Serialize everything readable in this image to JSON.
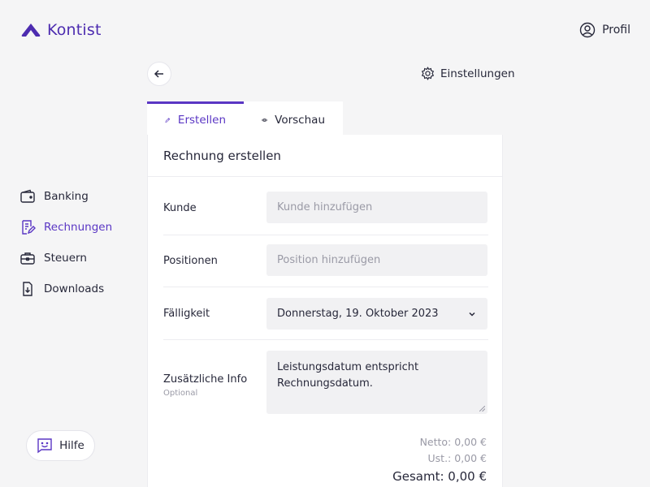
{
  "header": {
    "brand": "Kontist",
    "profile_label": "Profil"
  },
  "sidebar": {
    "items": [
      {
        "label": "Banking",
        "icon": "wallet-icon",
        "active": false
      },
      {
        "label": "Rechnungen",
        "icon": "invoice-icon",
        "active": true
      },
      {
        "label": "Steuern",
        "icon": "briefcase-icon",
        "active": false
      },
      {
        "label": "Downloads",
        "icon": "download-document-icon",
        "active": false
      }
    ],
    "help_label": "Hilfe"
  },
  "toolbar": {
    "settings_label": "Einstellungen"
  },
  "tabs": [
    {
      "label": "Erstellen",
      "icon": "pencil-icon",
      "active": true
    },
    {
      "label": "Vorschau",
      "icon": "eye-icon",
      "active": false
    }
  ],
  "form": {
    "title": "Rechnung erstellen",
    "customer": {
      "label": "Kunde",
      "placeholder": "Kunde hinzufügen"
    },
    "positions": {
      "label": "Positionen",
      "placeholder": "Position hinzufügen"
    },
    "due_date": {
      "label": "Fälligkeit",
      "value": "Donnerstag, 19. Oktober 2023"
    },
    "extra_info": {
      "label": "Zusätzliche Info",
      "sublabel": "Optional",
      "value": "Leistungsdatum entspricht Rechnungsdatum."
    }
  },
  "totals": {
    "net": "Netto: 0,00 €",
    "vat": "Ust.: 0,00 €",
    "total": "Gesamt: 0,00 €"
  },
  "colors": {
    "accent": "#5a36c4",
    "brand": "#4d2cb0",
    "background": "#f5f5f6"
  }
}
